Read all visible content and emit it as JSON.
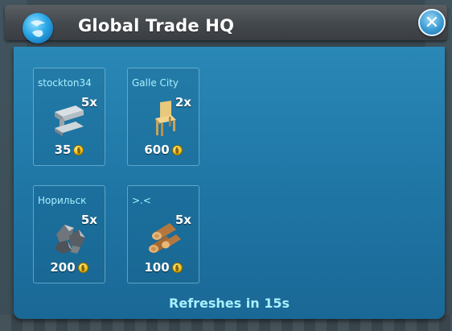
{
  "header": {
    "title": "Global Trade HQ"
  },
  "offers": [
    {
      "seller": "stockton34",
      "quantity": "5x",
      "price": "35",
      "item": "steel-beam-icon"
    },
    {
      "seller": "Galle City",
      "quantity": "2x",
      "price": "600",
      "item": "chair-icon"
    },
    {
      "seller": "Норильск",
      "quantity": "5x",
      "price": "200",
      "item": "metal-ore-icon"
    },
    {
      "seller": ">.<",
      "quantity": "5x",
      "price": "100",
      "item": "wood-logs-icon"
    }
  ],
  "footer": {
    "refresh_text": "Refreshes in 15s"
  },
  "colors": {
    "panel": "#1f77a6",
    "accent_text": "#a8f0ff",
    "coin": "#f2c318"
  }
}
